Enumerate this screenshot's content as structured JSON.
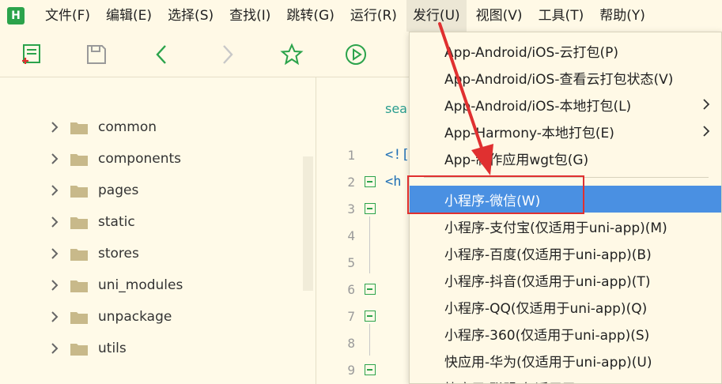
{
  "app": {
    "logo_letter": "H"
  },
  "menubar": {
    "items": [
      {
        "label": "文件(F)"
      },
      {
        "label": "编辑(E)"
      },
      {
        "label": "选择(S)"
      },
      {
        "label": "查找(I)"
      },
      {
        "label": "跳转(G)"
      },
      {
        "label": "运行(R)"
      },
      {
        "label": "发行(U)"
      },
      {
        "label": "视图(V)"
      },
      {
        "label": "工具(T)"
      },
      {
        "label": "帮助(Y)"
      }
    ],
    "active_index": 6
  },
  "sidebar": {
    "folders": [
      {
        "label": "common"
      },
      {
        "label": "components"
      },
      {
        "label": "pages"
      },
      {
        "label": "static"
      },
      {
        "label": "stores"
      },
      {
        "label": "uni_modules"
      },
      {
        "label": "unpackage"
      },
      {
        "label": "utils"
      }
    ],
    "folder_color": "#c8b98a"
  },
  "editor": {
    "top_text": "sea",
    "lines": [
      {
        "num": "1",
        "code": "<!["
      },
      {
        "num": "2",
        "code": "<h"
      },
      {
        "num": "3",
        "code": ""
      },
      {
        "num": "4",
        "code": ""
      },
      {
        "num": "5",
        "code": ""
      },
      {
        "num": "6",
        "code": ""
      },
      {
        "num": "7",
        "code": ""
      },
      {
        "num": "8",
        "code": ""
      },
      {
        "num": "9",
        "code": ""
      }
    ]
  },
  "dropdown": {
    "items": [
      {
        "label": "App-Android/iOS-云打包(P)"
      },
      {
        "label": "App-Android/iOS-查看云打包状态(V)"
      },
      {
        "label": "App-Android/iOS-本地打包(L)"
      },
      {
        "label": "App-Harmony-本地打包(E)"
      },
      {
        "label": "App-制作应用wgt包(G)"
      },
      {
        "label": "小程序-微信(W)"
      },
      {
        "label": "小程序-支付宝(仅适用于uni-app)(M)"
      },
      {
        "label": "小程序-百度(仅适用于uni-app)(B)"
      },
      {
        "label": "小程序-抖音(仅适用于uni-app)(T)"
      },
      {
        "label": "小程序-QQ(仅适用于uni-app)(Q)"
      },
      {
        "label": "小程序-360(仅适用于uni-app)(S)"
      },
      {
        "label": "快应用-华为(仅适用于uni-app)(U)"
      },
      {
        "label": "快应用-联盟(仅适用于uni-app)(K)"
      }
    ],
    "selected_index": 5,
    "selected_color": "#4a90e2"
  },
  "colors": {
    "accent_green": "#2ba34b",
    "annotation_red": "#e03030"
  }
}
